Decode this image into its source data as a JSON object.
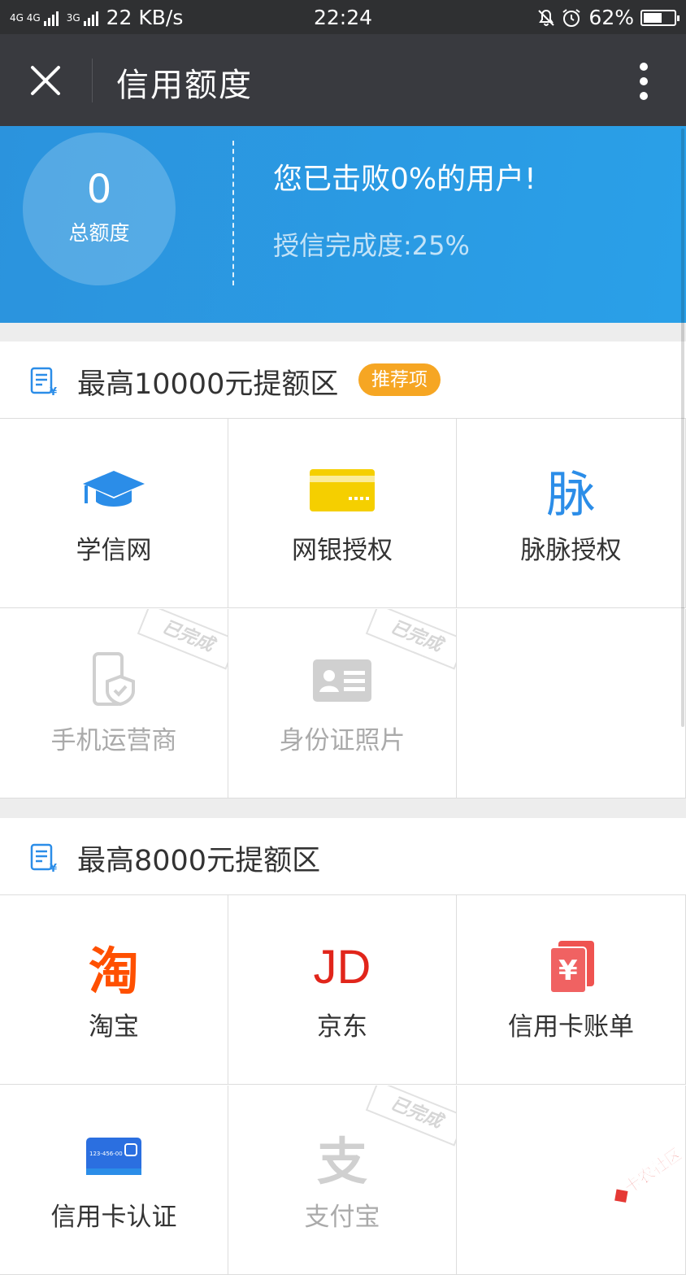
{
  "status_bar": {
    "network_left": "4G 4G",
    "network_right": "3G",
    "speed": "22 KB/s",
    "time": "22:24",
    "battery": "62%",
    "battery_level": 0.62
  },
  "title_bar": {
    "title": "信用额度"
  },
  "summary": {
    "total_amount": "0",
    "total_label": "总额度",
    "beat_text": "您已击败0%的用户!",
    "progress_text": "授信完成度:25%"
  },
  "section1": {
    "title": "最高10000元提额区",
    "badge": "推荐项",
    "items": [
      {
        "label": "学信网",
        "icon": "graduation-cap-icon",
        "done": false
      },
      {
        "label": "网银授权",
        "icon": "bank-card-icon",
        "done": false
      },
      {
        "label": "脉脉授权",
        "icon": "maimai-icon",
        "icon_text": "脉",
        "done": false
      },
      {
        "label": "手机运营商",
        "icon": "phone-shield-icon",
        "done": true
      },
      {
        "label": "身份证照片",
        "icon": "id-card-icon",
        "done": true
      }
    ],
    "done_stamp": "已完成"
  },
  "section2": {
    "title": "最高8000元提额区",
    "items": [
      {
        "label": "淘宝",
        "icon": "taobao-icon",
        "icon_text": "淘",
        "done": false
      },
      {
        "label": "京东",
        "icon": "jd-icon",
        "icon_text": "JD",
        "done": false
      },
      {
        "label": "信用卡账单",
        "icon": "credit-bill-icon",
        "done": false
      },
      {
        "label": "信用卡认证",
        "icon": "credit-card-icon",
        "card_number": "123-456-00",
        "done": false
      },
      {
        "label": "支付宝",
        "icon": "alipay-icon",
        "icon_text": "支",
        "done": true
      }
    ],
    "done_stamp": "已完成"
  },
  "watermark": {
    "text": "卡农社区"
  },
  "colors": {
    "header_blue": "#2b93dd",
    "badge_orange": "#f6a623",
    "icon_blue": "#2b8de8",
    "icon_yellow": "#f5cf00",
    "taobao_orange": "#ff5000",
    "jd_red": "#e1251b"
  }
}
